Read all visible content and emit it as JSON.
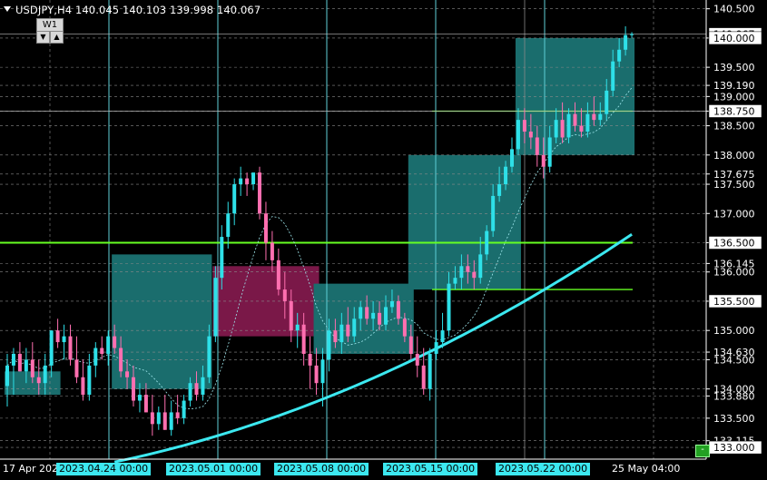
{
  "header": {
    "symbol_info": "USDJPY,H4  140.045 140.103 139.998 140.067",
    "timeframe_button": "W1",
    "scroll_down_glyph": "▼",
    "scroll_up_glyph": "▲"
  },
  "price_axis": {
    "labels": [
      "140.500",
      "140.000",
      "139.500",
      "139.190",
      "139.000",
      "138.750",
      "138.500",
      "138.000",
      "137.675",
      "137.500",
      "137.000",
      "136.500",
      "136.145",
      "136.000",
      "135.500",
      "135.000",
      "134.630",
      "134.500",
      "134.000",
      "133.880",
      "133.500",
      "133.115",
      "133.000"
    ],
    "highlighted": [
      {
        "label": "140.067",
        "price": 140.067,
        "bg": "#ffffff",
        "fg": "#000000"
      },
      {
        "label": "140.000",
        "price": 140.0,
        "bg": "#ffffff",
        "fg": "#000000"
      },
      {
        "label": "138.750",
        "price": 138.75,
        "bg": "#ffffff",
        "fg": "#000000"
      },
      {
        "label": "136.500",
        "price": 136.5,
        "bg": "#ffffff",
        "fg": "#000000"
      },
      {
        "label": "135.500",
        "price": 135.5,
        "bg": "#ffffff",
        "fg": "#000000"
      },
      {
        "label": "133.000",
        "price": 133.0,
        "bg": "#ffffff",
        "fg": "#000000"
      }
    ]
  },
  "time_axis": {
    "labels": [
      {
        "text": "17 Apr 2023",
        "highlight": false
      },
      {
        "text": "2023.04.24 00:00",
        "highlight": true
      },
      {
        "text": "2023.05.01 00:00",
        "highlight": true
      },
      {
        "text": "2023.05.08 00:00",
        "highlight": true
      },
      {
        "text": "2023.05.15 00:00",
        "highlight": true
      },
      {
        "text": "2023.05.22 00:00",
        "highlight": true
      },
      {
        "text": "25 May 04:00",
        "highlight": false
      }
    ]
  },
  "colors": {
    "background": "#000000",
    "grid": "#8a8a8a",
    "bull": "#2ee0e8",
    "bear": "#ff6fb0",
    "ma": "#3ce8f0",
    "period_separator": "#5fd0d8",
    "green_line": "#66ff22",
    "teal_box": "#1a6d6d",
    "pink_box": "#7a1848"
  },
  "chart_data": {
    "type": "candlestick",
    "title": "USDJPY,H4",
    "ylim": [
      132.8,
      140.65
    ],
    "yticks": [
      140.5,
      140.0,
      139.5,
      139.19,
      139.0,
      138.75,
      138.5,
      138.0,
      137.675,
      137.5,
      137.0,
      136.5,
      136.145,
      136.0,
      135.5,
      135.0,
      134.63,
      134.5,
      134.0,
      133.88,
      133.5,
      133.115,
      133.0
    ],
    "ohlc": {
      "open": [
        134.05,
        134.4,
        134.6,
        134.3,
        134.5,
        134.2,
        134.1,
        134.4,
        135.0,
        134.8,
        134.9,
        134.5,
        134.2,
        133.9,
        134.4,
        134.7,
        134.6,
        134.9,
        134.7,
        134.3,
        134.2,
        133.8,
        133.9,
        133.6,
        133.4,
        133.6,
        133.3,
        133.6,
        133.5,
        133.8,
        134.1,
        133.9,
        134.2,
        134.9,
        135.9,
        136.6,
        137.0,
        137.5,
        137.6,
        137.5,
        137.7,
        137.0,
        136.5,
        136.2,
        135.7,
        135.5,
        135.0,
        135.1,
        134.6,
        134.4,
        134.1,
        134.5,
        135.0,
        134.8,
        135.1,
        134.9,
        135.2,
        135.4,
        135.2,
        135.3,
        135.1,
        135.4,
        135.5,
        135.2,
        134.9,
        134.6,
        134.4,
        134.0,
        134.6,
        134.8,
        135.0,
        135.8,
        135.9,
        136.1,
        136.0,
        135.9,
        136.3,
        136.7,
        137.3,
        137.5,
        137.8,
        138.1,
        138.6,
        138.4,
        138.3,
        138.0,
        137.8,
        138.3,
        138.6,
        138.3,
        138.7,
        138.5,
        138.4,
        138.7,
        138.6,
        138.7,
        139.1,
        139.6,
        139.8,
        140.05
      ],
      "high": [
        134.6,
        134.7,
        134.8,
        134.7,
        134.8,
        134.5,
        134.6,
        134.9,
        135.2,
        135.1,
        135.1,
        134.9,
        134.5,
        134.6,
        134.8,
        134.9,
        135.0,
        135.1,
        134.9,
        134.5,
        134.4,
        134.1,
        134.1,
        133.9,
        133.7,
        133.9,
        133.8,
        133.9,
        133.9,
        134.2,
        134.3,
        134.4,
        135.1,
        136.1,
        136.8,
        137.2,
        137.6,
        137.8,
        137.7,
        137.6,
        137.8,
        137.2,
        136.7,
        136.4,
        136.0,
        135.7,
        135.3,
        135.3,
        134.9,
        134.7,
        134.7,
        135.2,
        135.2,
        135.3,
        135.4,
        135.4,
        135.5,
        135.6,
        135.5,
        135.5,
        135.6,
        135.7,
        135.6,
        135.3,
        135.1,
        134.9,
        134.7,
        134.7,
        135.0,
        135.3,
        136.0,
        136.1,
        136.3,
        136.3,
        136.2,
        136.6,
        136.8,
        137.5,
        137.8,
        137.9,
        138.3,
        138.8,
        138.8,
        138.7,
        138.5,
        138.3,
        138.5,
        138.8,
        138.9,
        138.8,
        138.9,
        138.8,
        138.9,
        139.0,
        138.9,
        139.3,
        139.8,
        140.0,
        140.2,
        140.1
      ],
      "low": [
        133.7,
        133.9,
        134.3,
        134.1,
        134.1,
        133.9,
        133.9,
        134.2,
        134.7,
        134.5,
        134.4,
        134.1,
        133.8,
        133.8,
        134.2,
        134.5,
        134.4,
        134.6,
        134.2,
        134.0,
        133.7,
        133.6,
        133.6,
        133.2,
        133.3,
        133.3,
        133.2,
        133.4,
        133.4,
        133.7,
        133.8,
        133.8,
        134.1,
        134.8,
        135.7,
        136.4,
        136.8,
        137.3,
        137.3,
        137.4,
        136.9,
        136.2,
        136.0,
        135.6,
        135.2,
        134.8,
        134.7,
        134.4,
        134.0,
        133.9,
        133.7,
        134.3,
        134.7,
        134.6,
        134.8,
        134.8,
        135.0,
        135.1,
        135.0,
        135.0,
        135.0,
        135.3,
        135.1,
        134.8,
        134.5,
        134.2,
        133.9,
        133.8,
        134.5,
        134.7,
        134.9,
        135.7,
        135.7,
        135.8,
        135.7,
        135.8,
        136.2,
        136.6,
        137.2,
        137.4,
        137.7,
        138.0,
        138.2,
        138.1,
        137.8,
        137.6,
        137.7,
        138.2,
        138.2,
        138.2,
        138.4,
        138.3,
        138.3,
        138.5,
        138.5,
        138.6,
        139.0,
        139.5,
        139.7,
        140.0
      ],
      "close": [
        134.4,
        134.6,
        134.3,
        134.5,
        134.2,
        134.1,
        134.4,
        135.0,
        134.8,
        134.9,
        134.5,
        134.2,
        133.9,
        134.4,
        134.7,
        134.6,
        134.9,
        134.7,
        134.3,
        134.2,
        133.8,
        133.9,
        133.6,
        133.4,
        133.6,
        133.3,
        133.6,
        133.5,
        133.8,
        134.1,
        133.9,
        134.2,
        134.9,
        135.9,
        136.6,
        137.0,
        137.5,
        137.6,
        137.5,
        137.7,
        137.0,
        136.5,
        136.2,
        135.7,
        135.5,
        135.0,
        135.1,
        134.6,
        134.4,
        134.1,
        134.5,
        135.0,
        134.8,
        135.1,
        134.9,
        135.2,
        135.4,
        135.2,
        135.3,
        135.1,
        135.4,
        135.5,
        135.2,
        134.9,
        134.6,
        134.4,
        134.0,
        134.6,
        134.8,
        135.0,
        135.8,
        135.9,
        136.1,
        136.0,
        135.9,
        136.3,
        136.7,
        137.3,
        137.5,
        137.8,
        138.1,
        138.6,
        138.4,
        138.3,
        138.0,
        137.8,
        138.3,
        138.6,
        138.3,
        138.7,
        138.5,
        138.4,
        138.7,
        138.6,
        138.7,
        139.1,
        139.6,
        139.8,
        140.05,
        140.067
      ]
    },
    "moving_average_end": 136.45,
    "horizontal_levels": [
      136.5,
      138.75,
      135.7
    ],
    "zones": [
      {
        "kind": "bull",
        "from_bar": 0,
        "to_bar": 8,
        "price_top": 134.3,
        "price_bottom": 133.9
      },
      {
        "kind": "bull",
        "from_bar": 17,
        "to_bar": 32,
        "price_top": 136.3,
        "price_bottom": 134.0
      },
      {
        "kind": "bear",
        "from_bar": 33,
        "to_bar": 49,
        "price_top": 136.1,
        "price_bottom": 134.9
      },
      {
        "kind": "bull",
        "from_bar": 49,
        "to_bar": 64,
        "price_top": 135.8,
        "price_bottom": 134.6
      },
      {
        "kind": "bull",
        "from_bar": 64,
        "to_bar": 81,
        "price_top": 138.0,
        "price_bottom": 135.7
      },
      {
        "kind": "bull",
        "from_bar": 81,
        "to_bar": 99,
        "price_top": 140.0,
        "price_bottom": 138.0
      }
    ]
  }
}
